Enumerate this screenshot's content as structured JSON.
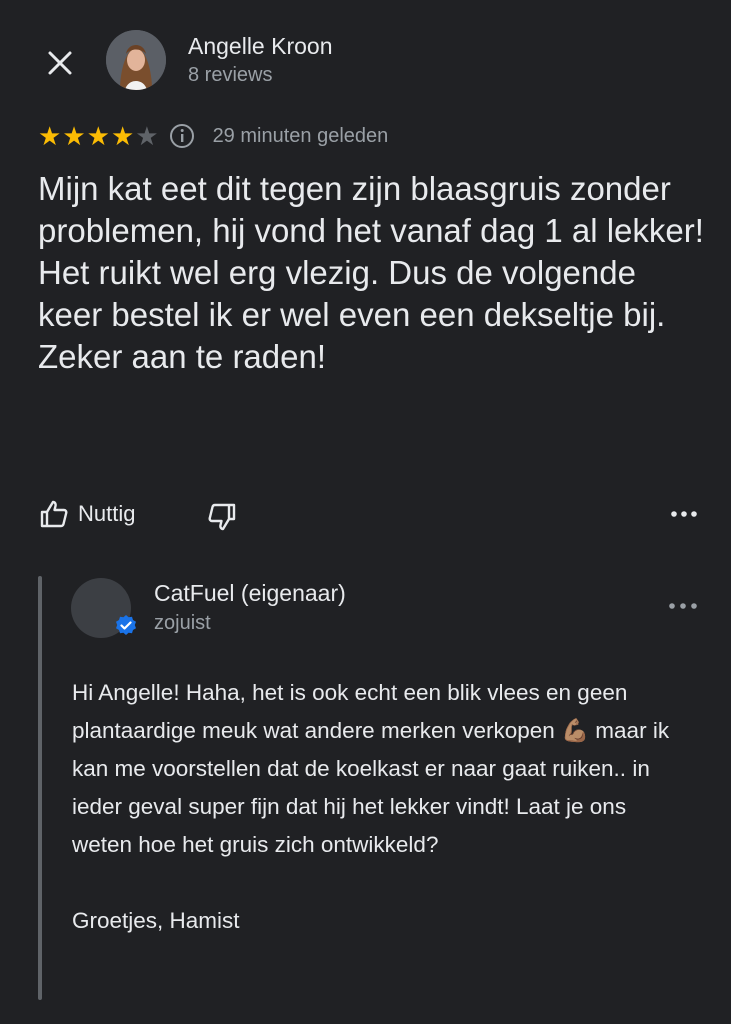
{
  "review": {
    "author": "Angelle Kroon",
    "review_count": "8 reviews",
    "rating": 4,
    "rating_max": 5,
    "time": "29 minuten geleden",
    "text": "Mijn kat eet dit tegen zijn blaasgruis zonder problemen, hij vond het vanaf dag 1 al lekker! Het ruikt wel erg vlezig. Dus de volgende keer bestel ik er wel even een dekseltje bij.\nZeker aan te raden!"
  },
  "actions": {
    "helpful_label": "Nuttig"
  },
  "reply": {
    "owner": "CatFuel (eigenaar)",
    "time": "zojuist",
    "text": "Hi Angelle! Haha, het is ook echt een blik vlees en geen plantaardige meuk wat andere merken verkopen 💪🏽 maar ik kan me voorstellen dat de koelkast er naar gaat ruiken.. in ieder geval super fijn dat hij het lekker vindt! Laat je ons weten hoe het gruis zich ontwikkeld?\n\nGroetjes, Hamist"
  },
  "colors": {
    "background": "#202124",
    "star": "#fbbc04",
    "verified": "#1a73e8"
  },
  "icons": [
    "close-icon",
    "info-icon",
    "thumbs-up-icon",
    "thumbs-down-icon",
    "more-icon",
    "verified-icon"
  ]
}
